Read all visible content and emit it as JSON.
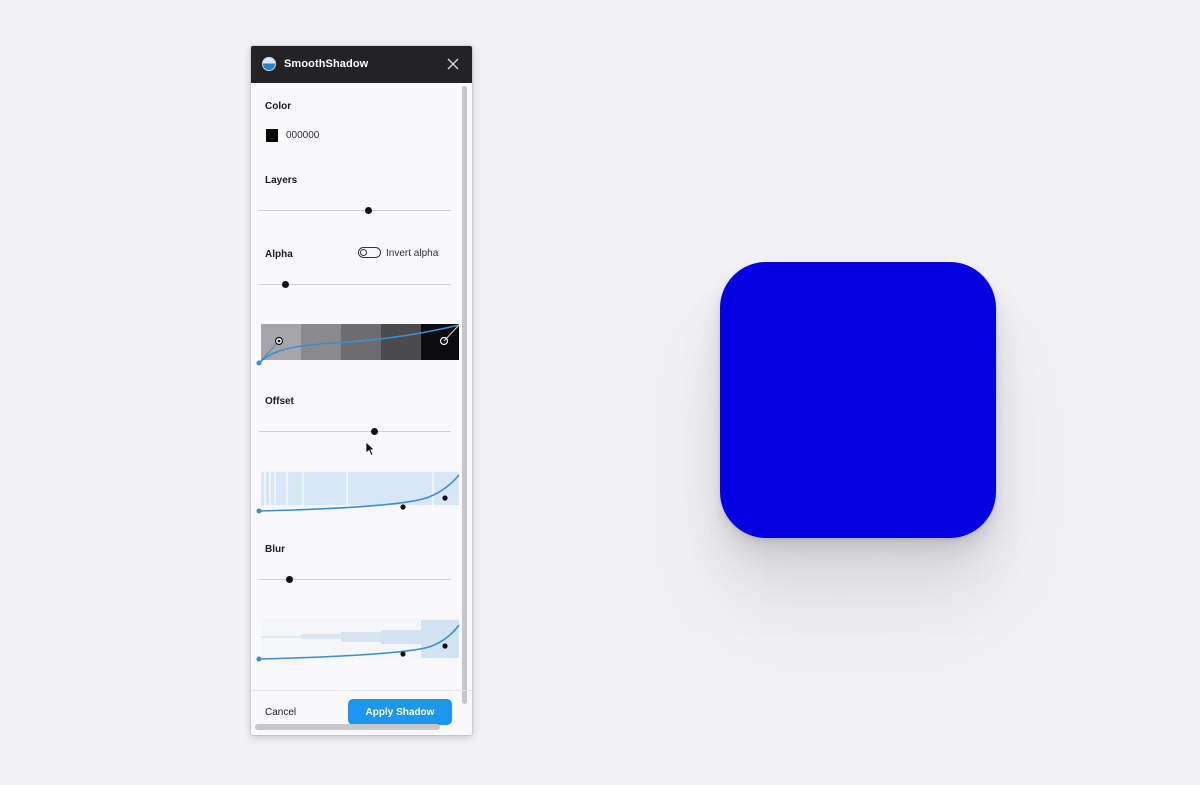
{
  "plugin": {
    "title": "SmoothShadow",
    "sections": {
      "color": {
        "label": "Color",
        "hex": "000000",
        "value_color": "#000000"
      },
      "layers": {
        "label": "Layers",
        "slider_value": 0.57
      },
      "alpha": {
        "label": "Alpha",
        "slider_value": 0.14,
        "invert_label": "Invert alpha",
        "invert_on": false
      },
      "offset": {
        "label": "Offset",
        "slider_value": 0.6
      },
      "blur": {
        "label": "Blur",
        "slider_value": 0.16
      }
    },
    "buttons": {
      "cancel": "Cancel",
      "apply": "Apply Shadow"
    }
  },
  "preview": {
    "fill_color": "#0500e0",
    "shape": "rounded-square"
  },
  "colors": {
    "accent": "#1d96f0",
    "curve": "#3a8fd0",
    "titlebar": "#232325"
  }
}
